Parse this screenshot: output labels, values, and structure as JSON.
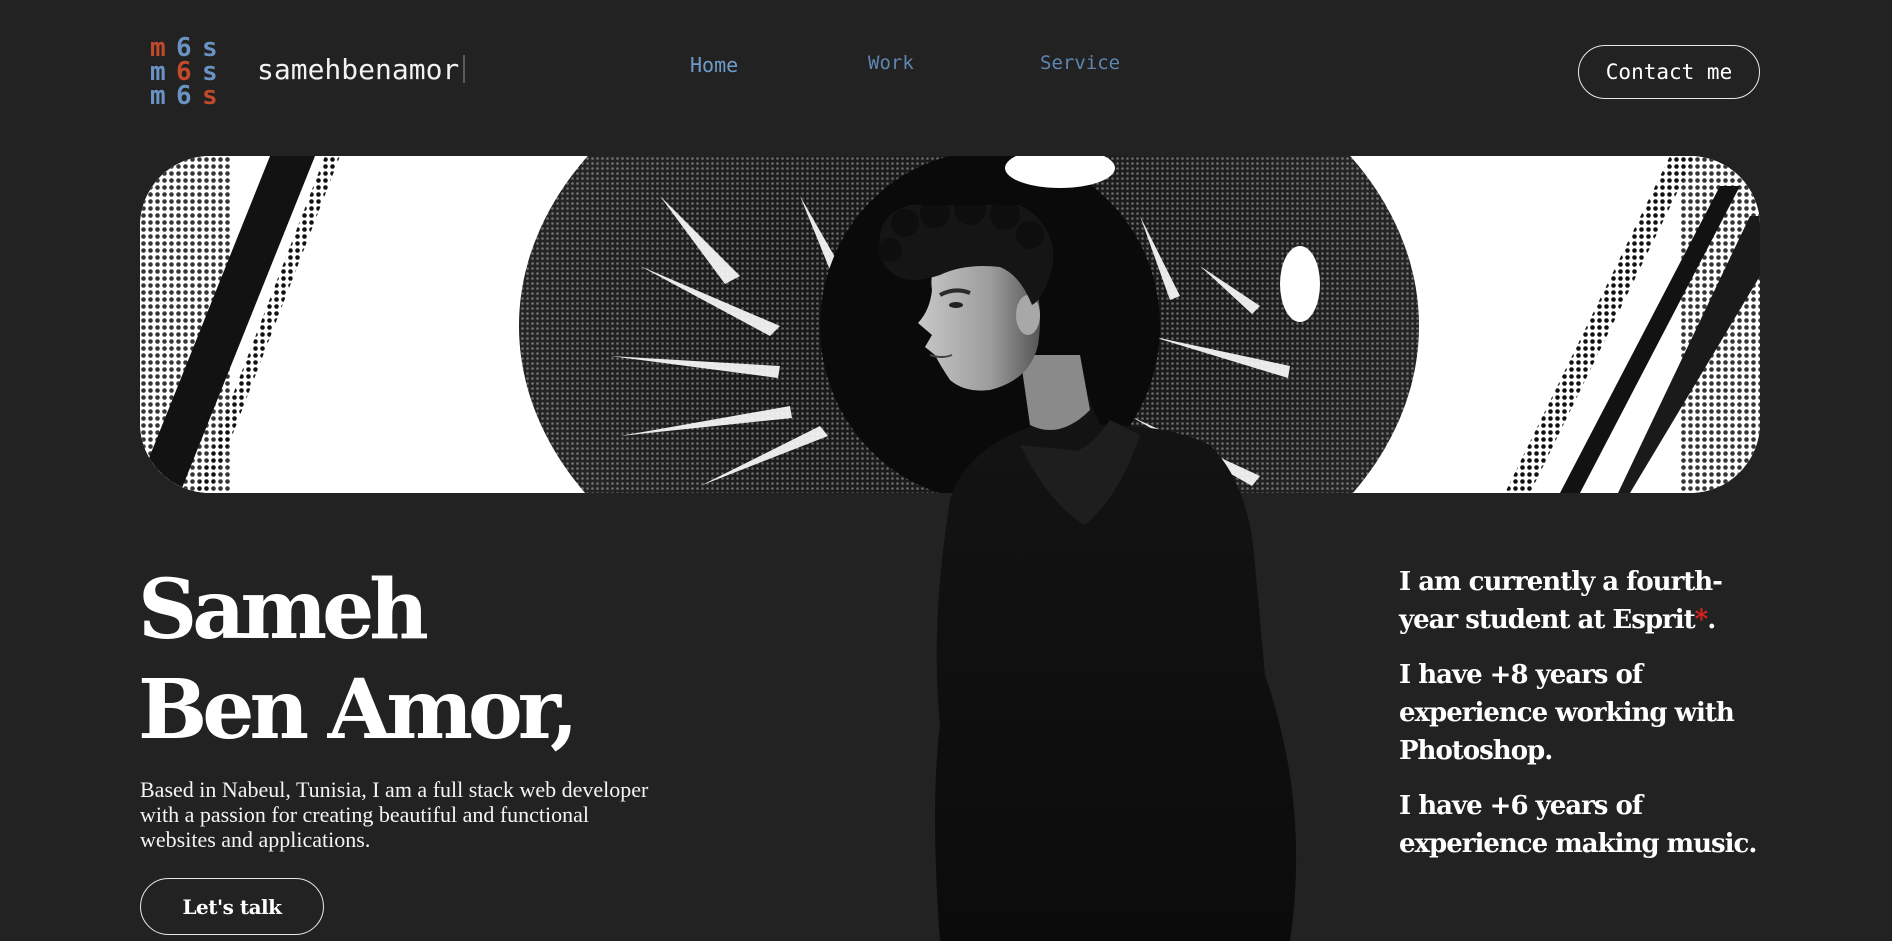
{
  "header": {
    "logo_icon": "mbs-monogram-logo",
    "brand": "samehbenamor",
    "nav": [
      {
        "label": "Home",
        "active": true
      },
      {
        "label": "Work",
        "active": false
      },
      {
        "label": "Service",
        "active": false
      }
    ],
    "contact_label": "Contact me"
  },
  "hero": {
    "banner_image": "halftone-eye-image",
    "portrait_image": "person-portrait-photo",
    "name_line1": "Sameh",
    "name_line2": "Ben Amor,",
    "description": "Based in Nabeul, Tunisia, I am a full stack web developer with a passion for creating beautiful and functional websites and applications.",
    "cta_label": "Let's talk"
  },
  "facts": {
    "fact1_text": "I am currently a fourth-year student at Esprit",
    "fact1_mark": "*",
    "fact1_end": ".",
    "fact2": "I have +8 years of experience working with Photoshop.",
    "fact3": "I have +6 years of experience making music."
  },
  "colors": {
    "background": "#222222",
    "nav_link": "#5f86b0",
    "logo_orange": "#c24a2a",
    "logo_blue": "#6a93c4",
    "asterisk": "#e02020"
  }
}
